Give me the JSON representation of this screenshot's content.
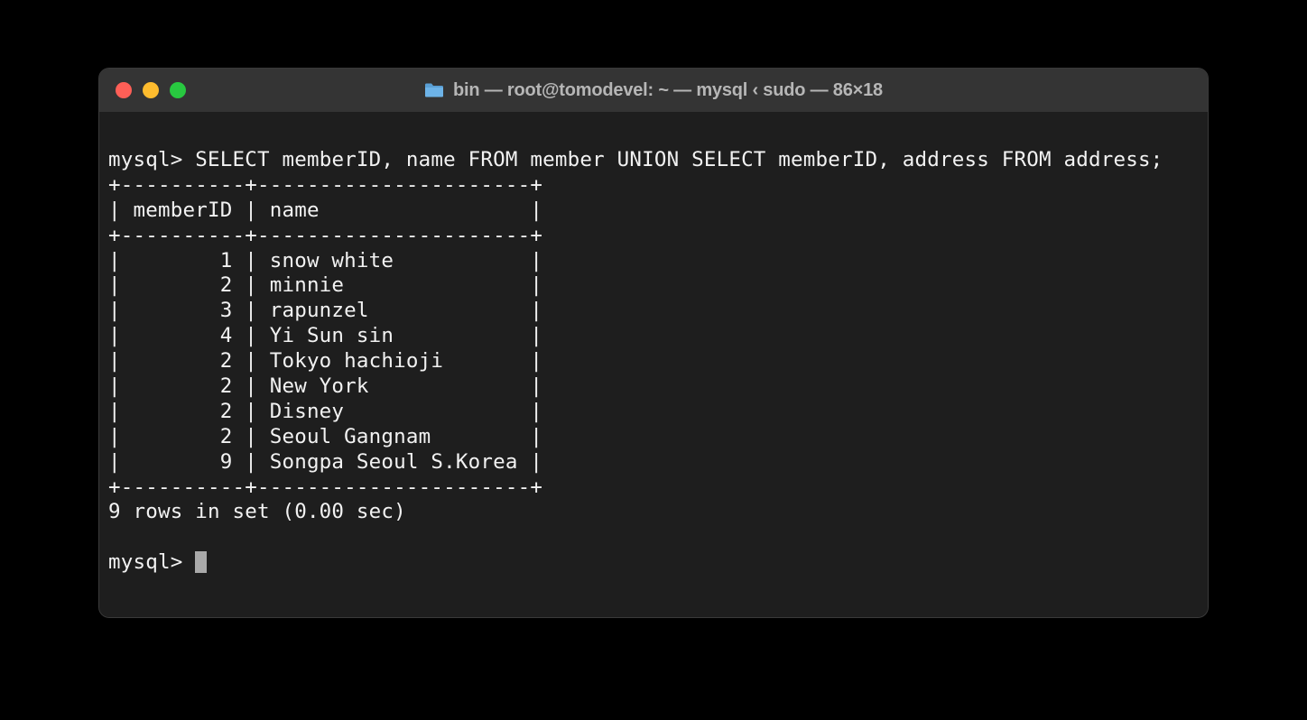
{
  "window": {
    "title": "bin — root@tomodevel: ~ — mysql ‹ sudo — 86×18"
  },
  "terminal": {
    "prompt": "mysql>",
    "query": "SELECT memberID, name FROM member UNION SELECT memberID, address FROM address;",
    "table": {
      "border_top": "+----------+----------------------+",
      "header": "| memberID | name                 |",
      "border_mid": "+----------+----------------------+",
      "rows": [
        "|        1 | snow white           |",
        "|        2 | minnie               |",
        "|        3 | rapunzel             |",
        "|        4 | Yi Sun sin           |",
        "|        2 | Tokyo hachioji       |",
        "|        2 | New York             |",
        "|        2 | Disney               |",
        "|        2 | Seoul Gangnam        |",
        "|        9 | Songpa Seoul S.Korea |"
      ],
      "border_bot": "+----------+----------------------+"
    },
    "status": "9 rows in set (0.00 sec)",
    "prompt2": "mysql> "
  }
}
